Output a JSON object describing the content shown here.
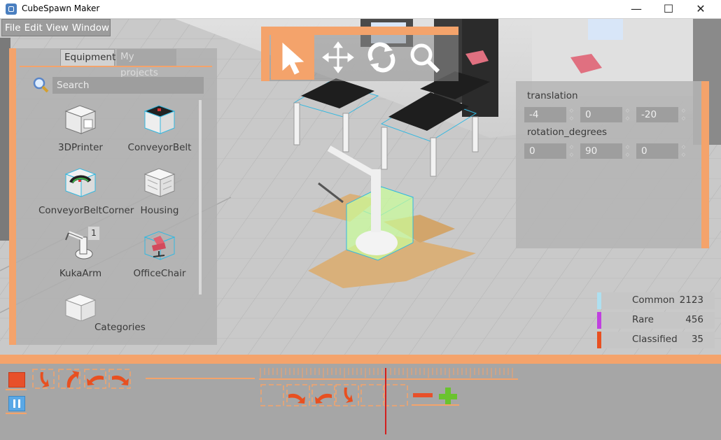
{
  "window": {
    "title": "CubeSpawn Maker",
    "minimize_glyph": "—",
    "maximize_glyph": "☐",
    "close_glyph": "✕"
  },
  "menu": [
    "File",
    "Edit",
    "View",
    "Window"
  ],
  "tools": [
    {
      "name": "select",
      "icon": "pointer-arrow-icon",
      "active": true
    },
    {
      "name": "move",
      "icon": "move-arrows-icon",
      "active": false
    },
    {
      "name": "rotate",
      "icon": "rotate-icon",
      "active": false
    },
    {
      "name": "zoom",
      "icon": "magnifier-icon",
      "active": false
    }
  ],
  "left_panel": {
    "tabs": [
      {
        "label": "Equipment",
        "active": true
      },
      {
        "label": "My projects",
        "active": false
      }
    ],
    "search": {
      "placeholder": "Search",
      "value": ""
    },
    "items": [
      {
        "label": "3DPrinter",
        "icon": "3d-printer-icon"
      },
      {
        "label": "ConveyorBelt",
        "icon": "conveyor-belt-icon"
      },
      {
        "label": "ConveyorBeltCorner",
        "icon": "conveyor-belt-corner-icon"
      },
      {
        "label": "Housing",
        "icon": "housing-icon"
      },
      {
        "label": "KukaArm",
        "icon": "kuka-arm-icon",
        "badge": "1"
      },
      {
        "label": "OfficeChair",
        "icon": "office-chair-icon"
      },
      {
        "label": "Categories",
        "icon": "categories-icon"
      }
    ]
  },
  "properties": {
    "translation_label": "translation",
    "translation": [
      "-4",
      "0",
      "-20"
    ],
    "rotation_label": "rotation_degrees",
    "rotation": [
      "0",
      "90",
      "0"
    ]
  },
  "stats": [
    {
      "name": "Common",
      "count": "2123",
      "color": "#aee0f0"
    },
    {
      "name": "Rare",
      "count": "456",
      "color": "#c040e0"
    },
    {
      "name": "Classified",
      "count": "35",
      "color": "#e85020"
    }
  ],
  "timeline": {
    "stop_icon": "stop-icon",
    "pause_icon": "pause-icon",
    "add_icon": "plus-icon",
    "remove_icon": "minus-icon"
  },
  "colors": {
    "accent": "#f4a36b",
    "panel": "#b0b0b0",
    "field": "#9e9e9e",
    "playhead": "#d21f1f"
  }
}
